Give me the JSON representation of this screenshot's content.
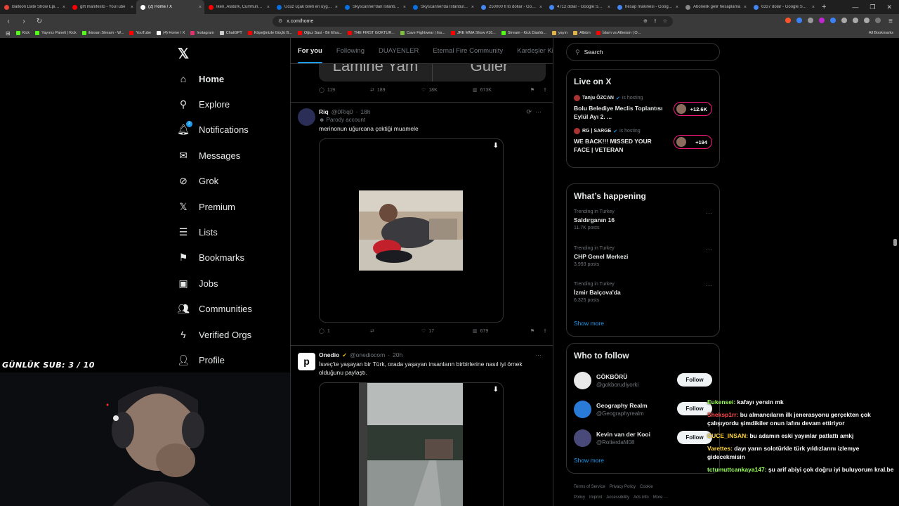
{
  "browser": {
    "tabs": [
      {
        "title": "Balloon Date Show Episode",
        "icon_color": "#ea4335",
        "active": false
      },
      {
        "title": "gift manifesto - YouTube",
        "icon_color": "#ff0000",
        "active": false
      },
      {
        "title": "(2) Home / X",
        "icon_color": "#ffffff",
        "active": true
      },
      {
        "title": "İken, Atatürk, Cumhuriyet ve",
        "icon_color": "#ff0000",
        "active": false
      },
      {
        "title": "Ucuz uçak bileti en uygun",
        "icon_color": "#0770e3",
        "active": false
      },
      {
        "title": "Skyscanner'dan İstanbul çı",
        "icon_color": "#0770e3",
        "active": false
      },
      {
        "title": "Skyscanner'da İstanbul-Tok",
        "icon_color": "#0770e3",
        "active": false
      },
      {
        "title": "250000 tl to dollar - Googl",
        "icon_color": "#4285f4",
        "active": false
      },
      {
        "title": "4712 dolar - Google Search",
        "icon_color": "#4285f4",
        "active": false
      },
      {
        "title": "hesap makinesi - Google S",
        "icon_color": "#4285f4",
        "active": false
      },
      {
        "title": "Abonelik gelir hesaplama",
        "icon_color": "#888888",
        "active": false
      },
      {
        "title": "6337 dolar - Google Search",
        "icon_color": "#4285f4",
        "active": false
      }
    ],
    "new_tab": "+",
    "url": "x.com/home",
    "bookmarks": [
      {
        "label": "Kick",
        "color": "#53fc18"
      },
      {
        "label": "Yayıncı Paneli | Kick",
        "color": "#53fc18"
      },
      {
        "label": "ikinsan Stream - W...",
        "color": "#53fc18"
      },
      {
        "label": "YouTube",
        "color": "#ff0000"
      },
      {
        "label": "(4) Home / X",
        "color": "#ffffff"
      },
      {
        "label": "Instagram",
        "color": "#e1306c"
      },
      {
        "label": "ChatGPT",
        "color": "#cccccc"
      },
      {
        "label": "Köpeğinizle Güçlü B...",
        "color": "#ff0000"
      },
      {
        "label": "Oğuz Sasi - Bir Efsa...",
        "color": "#ff0000"
      },
      {
        "label": "THE FIRST GOKTUR...",
        "color": "#ff0000"
      },
      {
        "label": "Cave Fightwear | Ins...",
        "color": "#7fbf3f"
      },
      {
        "label": "JRE MMA Show #16...",
        "color": "#ff0000"
      },
      {
        "label": "Stream - Kick Dashb...",
        "color": "#53fc18"
      },
      {
        "label": "yayın",
        "color": "#e0b34a"
      },
      {
        "label": "Albüm",
        "color": "#e0b34a"
      },
      {
        "label": "İslam vs Atheism | O...",
        "color": "#ff0000"
      }
    ],
    "all_bookmarks": "All Bookmarks"
  },
  "sidebar": {
    "items": [
      {
        "label": "Home",
        "icon": "home-icon",
        "glyph": "⌂",
        "bold": true
      },
      {
        "label": "Explore",
        "icon": "search-icon",
        "glyph": "⚲",
        "bold": false
      },
      {
        "label": "Notifications",
        "icon": "bell-icon",
        "glyph": "🔔︎",
        "bold": false,
        "badge": "2"
      },
      {
        "label": "Messages",
        "icon": "envelope-icon",
        "glyph": "✉",
        "bold": false
      },
      {
        "label": "Grok",
        "icon": "grok-icon",
        "glyph": "⊘",
        "bold": false
      },
      {
        "label": "Premium",
        "icon": "x-icon",
        "glyph": "𝕏",
        "bold": false
      },
      {
        "label": "Lists",
        "icon": "list-icon",
        "glyph": "☰",
        "bold": false
      },
      {
        "label": "Bookmarks",
        "icon": "bookmark-icon",
        "glyph": "⚑",
        "bold": false
      },
      {
        "label": "Jobs",
        "icon": "briefcase-icon",
        "glyph": "▣",
        "bold": false
      },
      {
        "label": "Communities",
        "icon": "people-icon",
        "glyph": "👥︎",
        "bold": false
      },
      {
        "label": "Verified Orgs",
        "icon": "lightning-icon",
        "glyph": "ϟ",
        "bold": false
      },
      {
        "label": "Profile",
        "icon": "person-icon",
        "glyph": "👤︎",
        "bold": false
      }
    ]
  },
  "timeline": {
    "tabs": [
      "For you",
      "Following",
      "DUAYENLER",
      "Eternal Fire Community",
      "Kardeşler Ki"
    ],
    "top_card_fragments": [
      "Lamine Yam",
      "Güler"
    ],
    "top_post_actions": {
      "replies": "119",
      "reposts": "189",
      "likes": "18K",
      "views": "673K"
    },
    "posts": [
      {
        "name": "Riq",
        "handle": "@0Riq0",
        "time": "18h",
        "subtitle": "Parody account",
        "text": "merinonun uğurcana çektiği muamele",
        "actions": {
          "replies": "1",
          "reposts": "",
          "likes": "17",
          "views": "679"
        }
      },
      {
        "name": "Onedio",
        "handle": "@onediocom",
        "time": "20h",
        "text": "İsveç'te yaşayan bir Türk, orada yaşayan insanların birbirlerine nasıl iyi örnek olduğunu paylaştı."
      }
    ]
  },
  "right": {
    "search_placeholder": "Search",
    "live": {
      "title": "Live on X",
      "items": [
        {
          "host": "Tanju ÖZCAN",
          "status": "is hosting",
          "title": "Bolu Belediye Meclis Toplantısı Eylül Ayı 2. ...",
          "count": "+12.6K"
        },
        {
          "host": "RG | SARGE",
          "status": "is hosting",
          "title": "WE BACK!!! MISSED YOUR FACE | VETERAN",
          "count": "+194"
        }
      ]
    },
    "happening": {
      "title": "What’s happening",
      "trends": [
        {
          "context": "Trending in Turkey",
          "name": "Saldırganın 16",
          "count": "11.7K posts"
        },
        {
          "context": "Trending in Turkey",
          "name": "CHP Genel Merkezi",
          "count": "3,993 posts"
        },
        {
          "context": "Trending in Turkey",
          "name": "İzmir Balçova'da",
          "count": "6,325 posts"
        }
      ],
      "show_more": "Show more"
    },
    "who_to_follow": {
      "title": "Who to follow",
      "accounts": [
        {
          "name": "GÖKBÖRÜ",
          "handle": "@gokborudiyorki",
          "button": "Follow"
        },
        {
          "name": "Geography Realm",
          "handle": "@Geographyrealm",
          "button": "Follow"
        },
        {
          "name": "Kevin van der Kooi",
          "handle": "@RotterdaM08",
          "button": "Follow"
        }
      ],
      "show_more": "Show more"
    },
    "footer": [
      "Terms of Service",
      "Privacy Policy",
      "Cookie Policy",
      "Imprint",
      "Accessibility",
      "Ads info",
      "More ···"
    ]
  },
  "overlay": {
    "sub_counter": "GÜNLÜK SUB: 3 / 10",
    "chat": [
      {
        "user": "Eukensei:",
        "text": " kafayı yersin mk",
        "color": "#9aff5a"
      },
      {
        "user": "Sheksp1rr:",
        "text": " bu almancıların ilk jenerasyonu gerçekten çok çalışıyordu şimdikiler onun lafını devam ettiriyor",
        "color": "#ff4b4b"
      },
      {
        "user": "CUCE_INSAN:",
        "text": " bu adamın eski yayınlar patlattı amkj",
        "color": "#ffd53a"
      },
      {
        "user": "Varettes:",
        "text": " dayı yarın solotürkle türk yıldızlarını izlemye gidecekmisin",
        "color": "#ffd53a"
      },
      {
        "user": "tctumuttcankaya147:",
        "text": " şu arif abiyi çok doğru iyi buluyorum kral.be",
        "color": "#9aff5a"
      }
    ]
  }
}
